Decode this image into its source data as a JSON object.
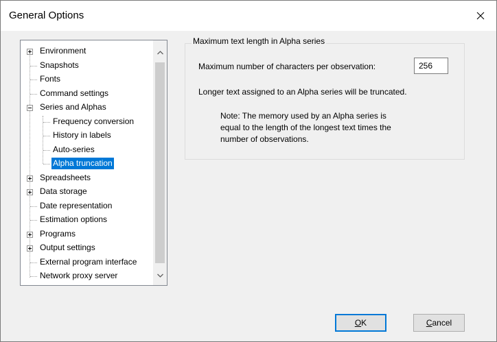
{
  "window": {
    "title": "General Options",
    "close_glyph": "✕"
  },
  "tree": {
    "items": [
      {
        "label": "Environment",
        "expandable": true
      },
      {
        "label": "Snapshots"
      },
      {
        "label": "Fonts"
      },
      {
        "label": "Command settings"
      },
      {
        "label": "Series and Alphas",
        "expandable": true,
        "expanded": true
      },
      {
        "label": "Frequency conversion"
      },
      {
        "label": "History in labels"
      },
      {
        "label": "Auto-series"
      },
      {
        "label": "Alpha truncation",
        "selected": true
      },
      {
        "label": "Spreadsheets",
        "expandable": true
      },
      {
        "label": "Data storage",
        "expandable": true
      },
      {
        "label": "Date representation"
      },
      {
        "label": "Estimation options"
      },
      {
        "label": "Programs",
        "expandable": true
      },
      {
        "label": "Output settings",
        "expandable": true
      },
      {
        "label": "External program interface"
      },
      {
        "label": "Network proxy server"
      }
    ],
    "scroll_up_icon": "chevron-up-icon",
    "scroll_down_icon": "chevron-down-icon"
  },
  "panel": {
    "group_title": "Maximum text length in Alpha series",
    "max_chars_label": "Maximum number of characters per observation:",
    "max_chars_value": "256",
    "truncation_text": "Longer text assigned to an Alpha series will be truncated.",
    "note_lines": [
      "Note: The memory used by an Alpha series is",
      "equal to the length of the longest text times the",
      "number of observations."
    ]
  },
  "buttons": {
    "ok_label": "OK",
    "ok_mnemonic": "O",
    "ok_rest": "K",
    "cancel_label": "Cancel",
    "cancel_mnemonic": "C",
    "cancel_rest": "ancel"
  },
  "colors": {
    "selection": "#0078d7",
    "window_bg": "#f0f0f0"
  }
}
